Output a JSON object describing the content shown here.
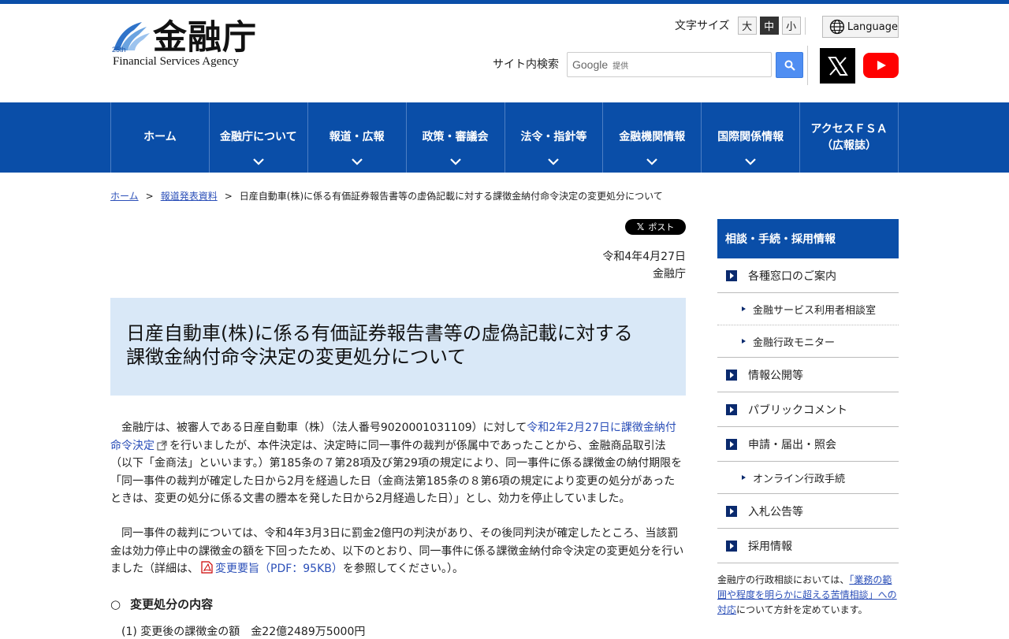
{
  "header": {
    "logo_jp": "金融庁",
    "logo_en": "Financial Services Agency",
    "fontsize_label": "文字サイズ",
    "fontsize_options": [
      "大",
      "中",
      "小"
    ],
    "fontsize_selected": "中",
    "language_label": "Language",
    "search_label": "サイト内検索",
    "search_google": "Google",
    "search_provided": "提供",
    "colors": {
      "brand": "#0a4ea8",
      "search_button": "#4f8ef2",
      "youtube": "#ff0000"
    }
  },
  "nav": {
    "items": [
      {
        "label": "ホーム"
      },
      {
        "label": "金融庁について"
      },
      {
        "label": "報道・広報"
      },
      {
        "label": "政策・審議会"
      },
      {
        "label": "法令・指針等"
      },
      {
        "label": "金融機関情報"
      },
      {
        "label": "国際関係情報"
      },
      {
        "label": "アクセスＦＳＡ",
        "label2": "（広報誌）"
      }
    ]
  },
  "breadcrumb": {
    "home": "ホーム",
    "parent": "報道発表資料",
    "sep": ">",
    "current": "日産自動車(株)に係る有価証券報告書等の虚偽記載に対する課徴金納付命令決定の変更処分について"
  },
  "article": {
    "post_label": "ポスト",
    "date": "令和4年4月27日",
    "author": "金融庁",
    "title_line1": "日産自動車(株)に係る有価証券報告書等の虚偽記載に対する",
    "title_line2": "課徴金納付命令決定の変更処分について",
    "p1_before": "金融庁は、被審人である日産自動車（株）（法人番号9020001031109）に対して",
    "p1_link": "令和2年2月27日に課徴金納付命令決定",
    "p1_after": "を行いましたが、本件決定は、決定時に同一事件の裁判が係属中であったことから、金融商品取引法（以下「金商法」といいます。）第185条の７第28項及び第29項の規定により、同一事件に係る課徴金の納付期限を「同一事件の裁判が確定した日から2月を経過した日（金商法第185条の８第6項の規定により変更の処分があったときは、変更の処分に係る文書の謄本を発した日から2月経過した日）」とし、効力を停止していました。",
    "p2_before": "同一事件の裁判については、令和4年3月3日に罰金2億円の判決があり、その後同判決が確定したところ、当該罰金は効力停止中の課徴金の額を下回ったため、以下のとおり、同一事件に係る課徴金納付命令決定の変更処分を行いました（詳細は、",
    "p2_link": "変更要旨（PDF：95KB）",
    "p2_after": "を参照してください。）。",
    "section_marker": "○",
    "section_heading": "変更処分の内容",
    "item1": "(1) 変更後の課徴金の額　金22億2489万5000円"
  },
  "sidebar": {
    "heading": "相談・手続・採用情報",
    "items": [
      {
        "label": "各種窓口のご案内",
        "subs": [
          "金融サービス利用者相談室",
          "金融行政モニター"
        ]
      },
      {
        "label": "情報公開等"
      },
      {
        "label": "パブリックコメント"
      },
      {
        "label": "申請・届出・照会",
        "subs": [
          "オンライン行政手続"
        ]
      },
      {
        "label": "入札公告等"
      },
      {
        "label": "採用情報"
      }
    ],
    "note_before": "金融庁の行政相談においては、",
    "note_link": "「業務の範囲や程度を明らかに超える苦情相談」への対応",
    "note_after": "について方針を定めています。"
  }
}
